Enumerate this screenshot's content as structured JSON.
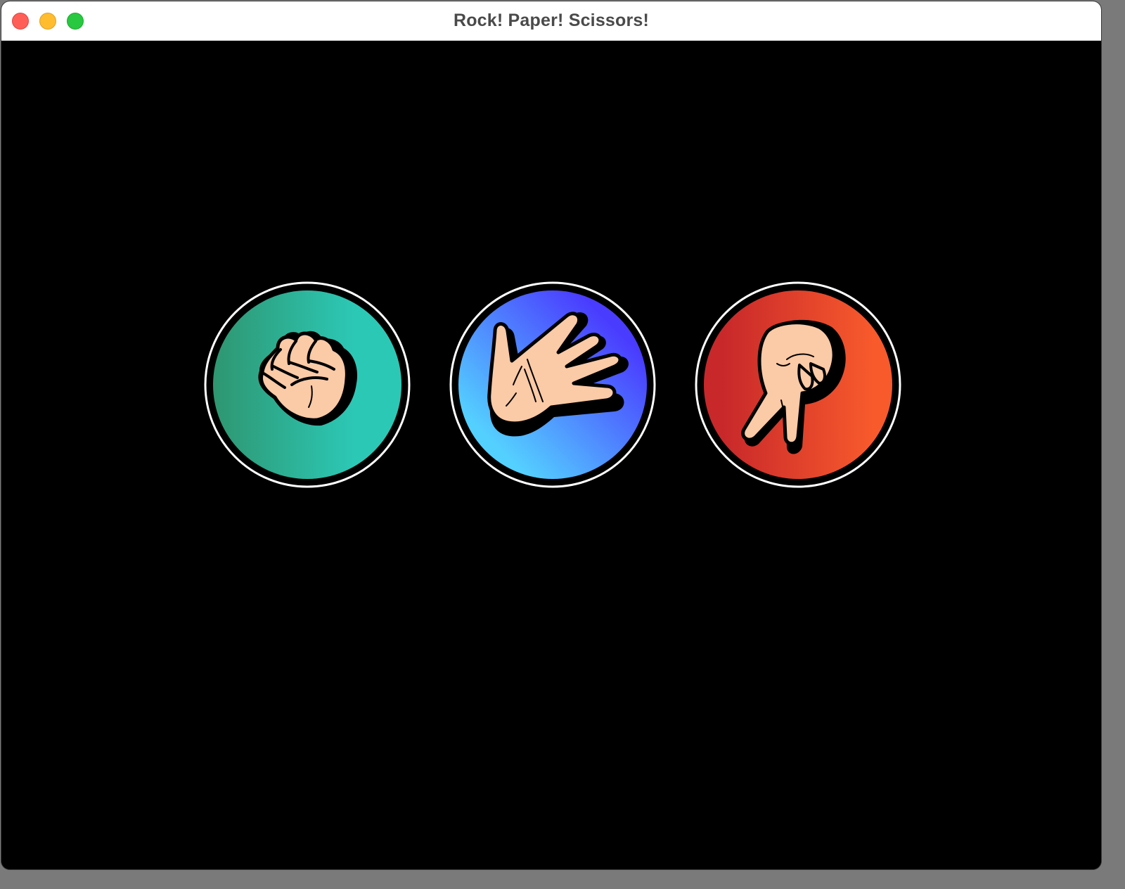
{
  "window": {
    "title": "Rock! Paper! Scissors!"
  },
  "choices": [
    {
      "id": "rock",
      "icon": "fist-icon",
      "gradient": [
        "#2e9670",
        "#2cc8b6"
      ]
    },
    {
      "id": "paper",
      "icon": "open-hand-icon",
      "gradient": [
        "#54d0ff",
        "#4a3cff"
      ]
    },
    {
      "id": "scissors",
      "icon": "scissors-hand-icon",
      "gradient": [
        "#c8282a",
        "#f85a2c"
      ]
    }
  ],
  "colors": {
    "background": "#000000",
    "ring": "#ffffff",
    "skin": "#fbcaa6",
    "outline": "#000000"
  }
}
